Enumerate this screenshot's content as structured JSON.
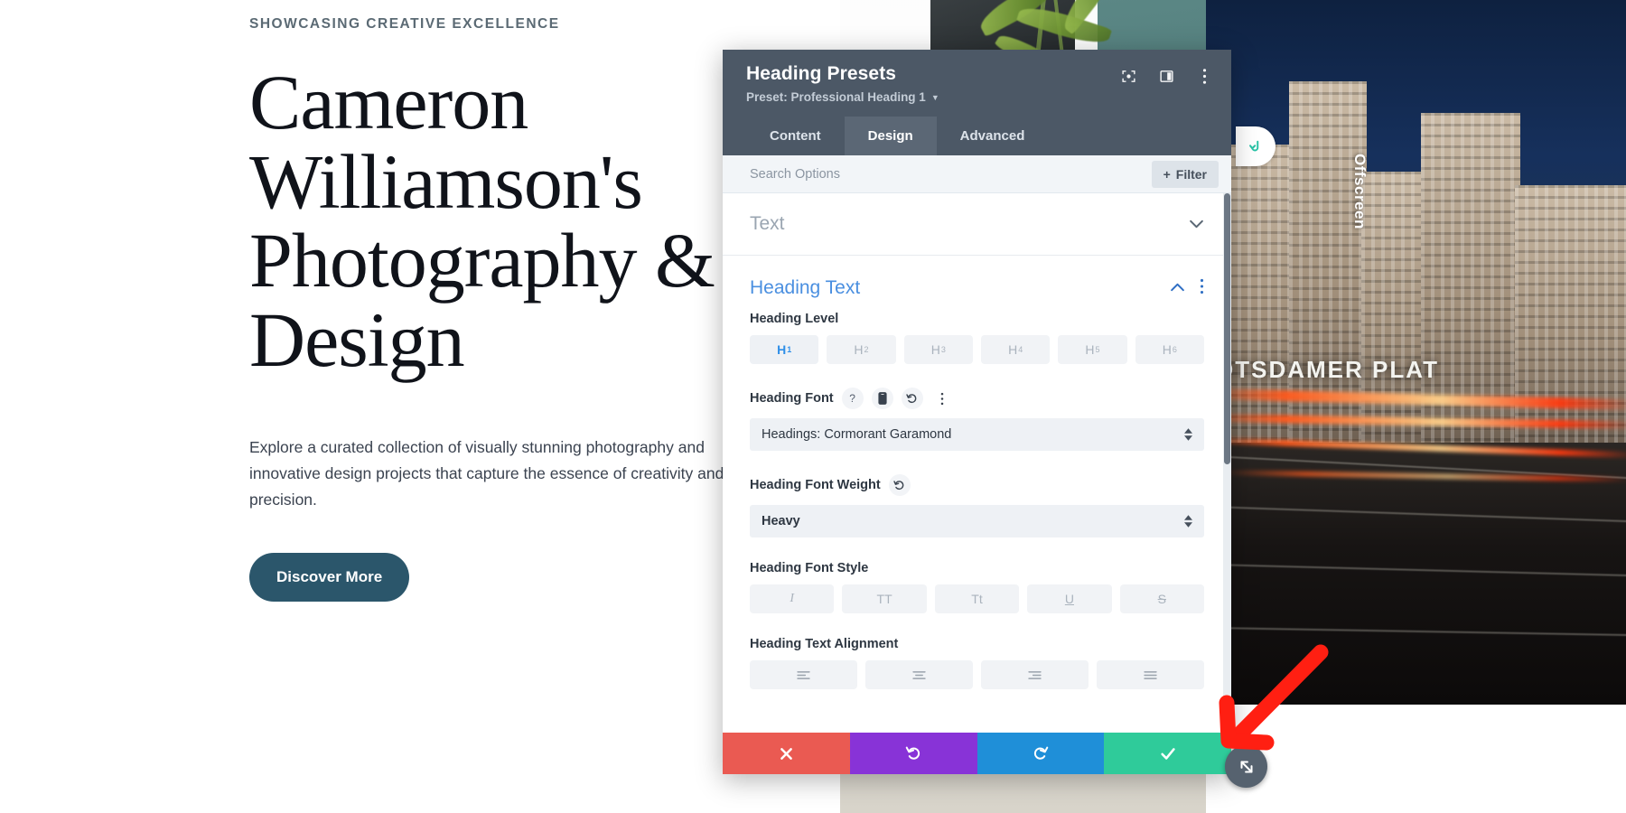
{
  "website": {
    "eyebrow": "SHOWCASING CREATIVE EXCELLENCE",
    "title": "Cameron Williamson's Photography & Design",
    "body": "Explore a curated collection of visually stunning photography and innovative design projects that capture the essence of creativity and precision.",
    "cta_label": "Discover More",
    "offscreen_label": "Offscreen",
    "colors": {
      "cta_background": "#2b566b",
      "eyebrow_text": "#5b6a74",
      "title_text": "#10131a"
    }
  },
  "modal": {
    "title": "Heading Presets",
    "preset_label": "Preset: Professional Heading 1",
    "header_icons": [
      {
        "name": "focus-target-icon"
      },
      {
        "name": "panel-layout-icon"
      },
      {
        "name": "more-vertical-icon"
      }
    ],
    "tabs": [
      {
        "label": "Content",
        "active": false
      },
      {
        "label": "Design",
        "active": true
      },
      {
        "label": "Advanced",
        "active": false
      }
    ],
    "search": {
      "placeholder": "Search Options",
      "value": "",
      "filter_label": "Filter"
    },
    "groups": [
      {
        "title": "Text",
        "state": "collapsed"
      },
      {
        "title": "Heading Text",
        "state": "expanded"
      }
    ],
    "fields": {
      "heading_level": {
        "label": "Heading Level",
        "options": [
          {
            "label": "H",
            "sub": "1",
            "active": true
          },
          {
            "label": "H",
            "sub": "2",
            "active": false
          },
          {
            "label": "H",
            "sub": "3",
            "active": false
          },
          {
            "label": "H",
            "sub": "4",
            "active": false
          },
          {
            "label": "H",
            "sub": "5",
            "active": false
          },
          {
            "label": "H",
            "sub": "6",
            "active": false
          }
        ]
      },
      "heading_font": {
        "label": "Heading Font",
        "value": "Headings: Cormorant Garamond",
        "icons": [
          "help-icon",
          "mobile-device-icon",
          "reset-icon",
          "more-vertical-icon"
        ]
      },
      "heading_font_weight": {
        "label": "Heading Font Weight",
        "value": "Heavy",
        "icons": [
          "reset-icon"
        ]
      },
      "heading_font_style": {
        "label": "Heading Font Style",
        "options": [
          {
            "glyph": "I",
            "name": "italic"
          },
          {
            "glyph": "TT",
            "name": "uppercase"
          },
          {
            "glyph": "Tt",
            "name": "capitalize"
          },
          {
            "glyph": "U",
            "name": "underline"
          },
          {
            "glyph": "S",
            "name": "strikethrough"
          }
        ]
      },
      "heading_text_alignment": {
        "label": "Heading Text Alignment",
        "options": [
          {
            "name": "align-left"
          },
          {
            "name": "align-center"
          },
          {
            "name": "align-right"
          },
          {
            "name": "align-justify"
          }
        ]
      }
    },
    "footer_buttons": [
      {
        "name": "cancel-button",
        "icon": "close-icon",
        "color": "#ea5a52"
      },
      {
        "name": "undo-button",
        "icon": "undo-icon",
        "color": "#8833d7"
      },
      {
        "name": "redo-button",
        "icon": "redo-icon",
        "color": "#1f8fd8"
      },
      {
        "name": "save-button",
        "icon": "check-icon",
        "color": "#2fcb9a"
      }
    ]
  },
  "photo": {
    "street_sign": "OTSDAMER PLAT"
  }
}
